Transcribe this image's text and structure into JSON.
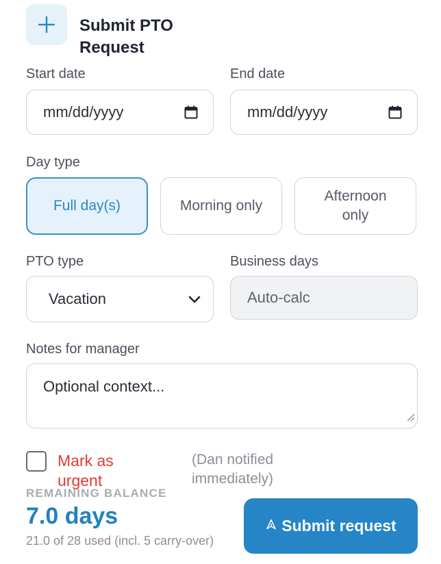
{
  "form": {
    "title": "Submit PTO Request",
    "start_date": {
      "label": "Start date",
      "placeholder": "mm/dd/yyyy"
    },
    "end_date": {
      "label": "End date",
      "placeholder": "mm/dd/yyyy"
    },
    "day_type": {
      "label": "Day type",
      "options": [
        {
          "label": "Full day(s)",
          "selected": true
        },
        {
          "label": "Morning only",
          "selected": false
        },
        {
          "label": "Afternoon only",
          "selected": false
        }
      ]
    },
    "pto_type": {
      "label": "PTO type",
      "value": "Vacation"
    },
    "business_days": {
      "label": "Business days",
      "placeholder": "Auto-calc"
    },
    "notes": {
      "label": "Notes for manager",
      "placeholder": "Optional context..."
    },
    "urgent": {
      "label": "Mark as urgent",
      "note": "(Dan notified immediately)",
      "checked": false
    }
  },
  "balance": {
    "label": "REMAINING BALANCE",
    "value": "7.0 days",
    "used": "21.0 of 28 used (incl. 5 carry-over)"
  },
  "submit": {
    "label": "Submit request"
  },
  "colors": {
    "accent": "#2585c6",
    "urgent": "#e03b33",
    "selected_bg": "#e5f2fb"
  },
  "icons": {
    "header": "plus-icon",
    "date": "calendar-icon",
    "select": "chevron-down-icon",
    "submit": "send-icon"
  }
}
